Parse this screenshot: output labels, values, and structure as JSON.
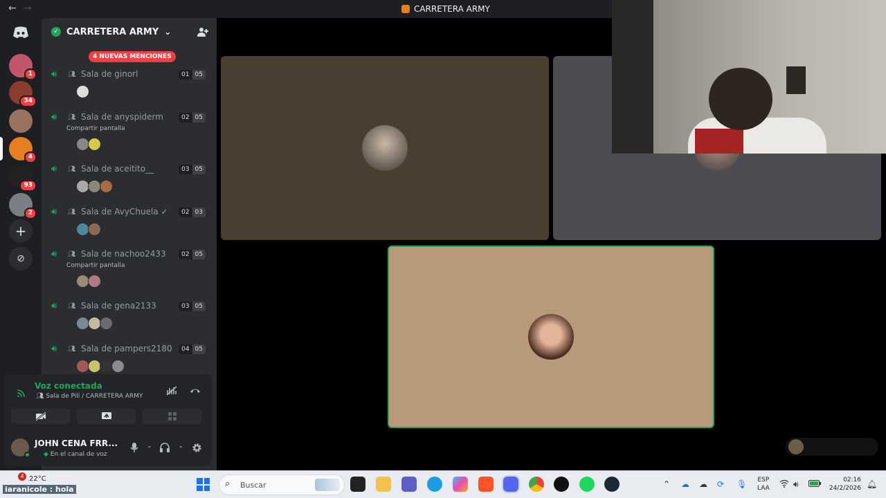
{
  "window": {
    "title": "CARRETERA ARMY",
    "back": "←",
    "forward": "→"
  },
  "server": {
    "name": "CARRETERA ARMY",
    "chevron": "⌄",
    "mentions_banner": "4 NUEVAS MENCIONES"
  },
  "rail_badges": [
    "1",
    "34",
    "4",
    "93",
    "2"
  ],
  "rooms": [
    {
      "name": "Sala de ginorl",
      "count": "01",
      "limit": "05",
      "sub": ""
    },
    {
      "name": "Sala de anyspiderm",
      "count": "02",
      "limit": "05",
      "sub": "Compartir pantalla"
    },
    {
      "name": "Sala de aceitito__",
      "count": "03",
      "limit": "05",
      "sub": ""
    },
    {
      "name": "Sala de AvyChuela ✓",
      "count": "02",
      "limit": "03",
      "sub": ""
    },
    {
      "name": "Sala de nachoo2433",
      "count": "02",
      "limit": "05",
      "sub": "Compartir pantalla"
    },
    {
      "name": "Sala de gena2133",
      "count": "03",
      "limit": "05",
      "sub": ""
    },
    {
      "name": "Sala de pampers2180",
      "count": "04",
      "limit": "05",
      "sub": ""
    }
  ],
  "voice": {
    "status": "Voz conectada",
    "channel": "Sala de Pili / CARRETERA ARMY"
  },
  "user": {
    "name": "JOHN CENA FRR...",
    "status": "En el canal de voz"
  },
  "taskbar": {
    "weather_badge": "4",
    "weather": "22°C",
    "chat_overlay": "iaranicole : hola",
    "search_placeholder": "Buscar",
    "lang_line1": "ESP",
    "lang_line2": "LAA",
    "time": "02:16",
    "date": "24/2/2026"
  },
  "colors": {
    "green": "#23a55a",
    "red": "#f23f43",
    "tile1": "#4a3e31",
    "tile2": "#4c4d52",
    "tile3": "#b89a7b"
  }
}
